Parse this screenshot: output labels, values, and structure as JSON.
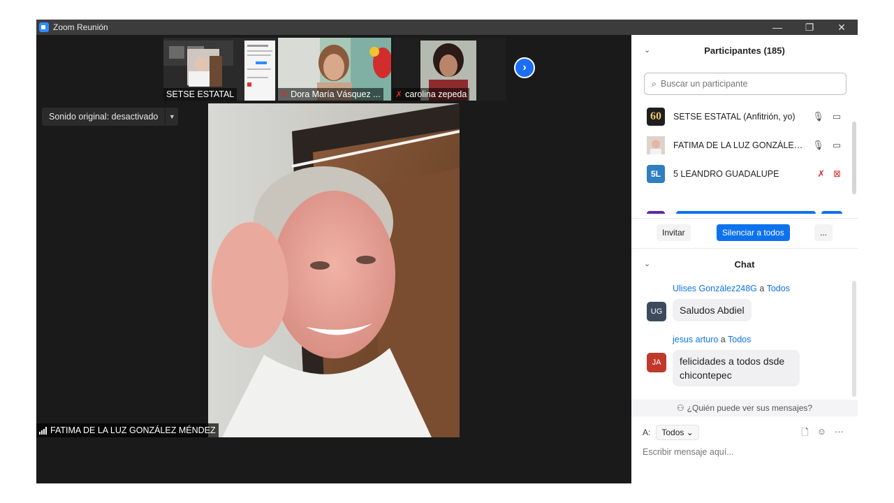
{
  "window": {
    "title": "Zoom Reunión",
    "controls": [
      "—",
      "❐",
      "✕"
    ]
  },
  "stage": {
    "thumbnails": [
      {
        "name": "SETSE ESTATAL",
        "muted": false
      },
      {
        "name": "Dora María Vásquez ...",
        "muted": true
      },
      {
        "name": "carolina zepeda",
        "muted": true
      }
    ],
    "next_icon": "chevron-right-icon",
    "sound_label": "Sonido original: desactivado",
    "active_speaker": "FATIMA DE LA LUZ GONZÁLEZ MÉNDEZ"
  },
  "participants": {
    "title": "Participantes (185)",
    "search_placeholder": "Buscar un participante",
    "list": [
      {
        "avatar": "60",
        "name": "SETSE ESTATAL (Anfitrión, yo)",
        "avatar_color": "#1e1e1e",
        "mic": "on",
        "video": "on"
      },
      {
        "avatar": "",
        "name": "FATIMA DE LA LUZ GONZÁLEZ ...",
        "avatar_color": "#c9b8b0",
        "mic": "on",
        "video": "on"
      },
      {
        "avatar": "5L",
        "name": "5 LEANDRO GUADALUPE",
        "avatar_color": "#2f7fc1",
        "mic": "muted",
        "video": "off"
      }
    ],
    "invite_label": "Invitar",
    "mute_all_label": "Silenciar a todos",
    "more_label": "..."
  },
  "chat": {
    "title": "Chat",
    "messages": [
      {
        "sender": "Ulises González248G",
        "to_word": "a",
        "recipient": "Todos",
        "initials": "UG",
        "avatar_color": "#3c4a5c",
        "text": "Saludos Abdiel"
      },
      {
        "sender": "jesus arturo",
        "to_word": "a",
        "recipient": "Todos",
        "initials": "JA",
        "avatar_color": "#c0392b",
        "text": "felicidades a todos dsde chicontepec"
      }
    ],
    "who_can_see": "¿Quién puede ver sus mensajes?",
    "to_label": "A:",
    "to_value": "Todos",
    "input_placeholder": "Escribir mensaje aquí..."
  },
  "colors": {
    "accent": "#0e72ed",
    "stage_bg": "#1a1a1a",
    "muted_red": "#e02828"
  }
}
